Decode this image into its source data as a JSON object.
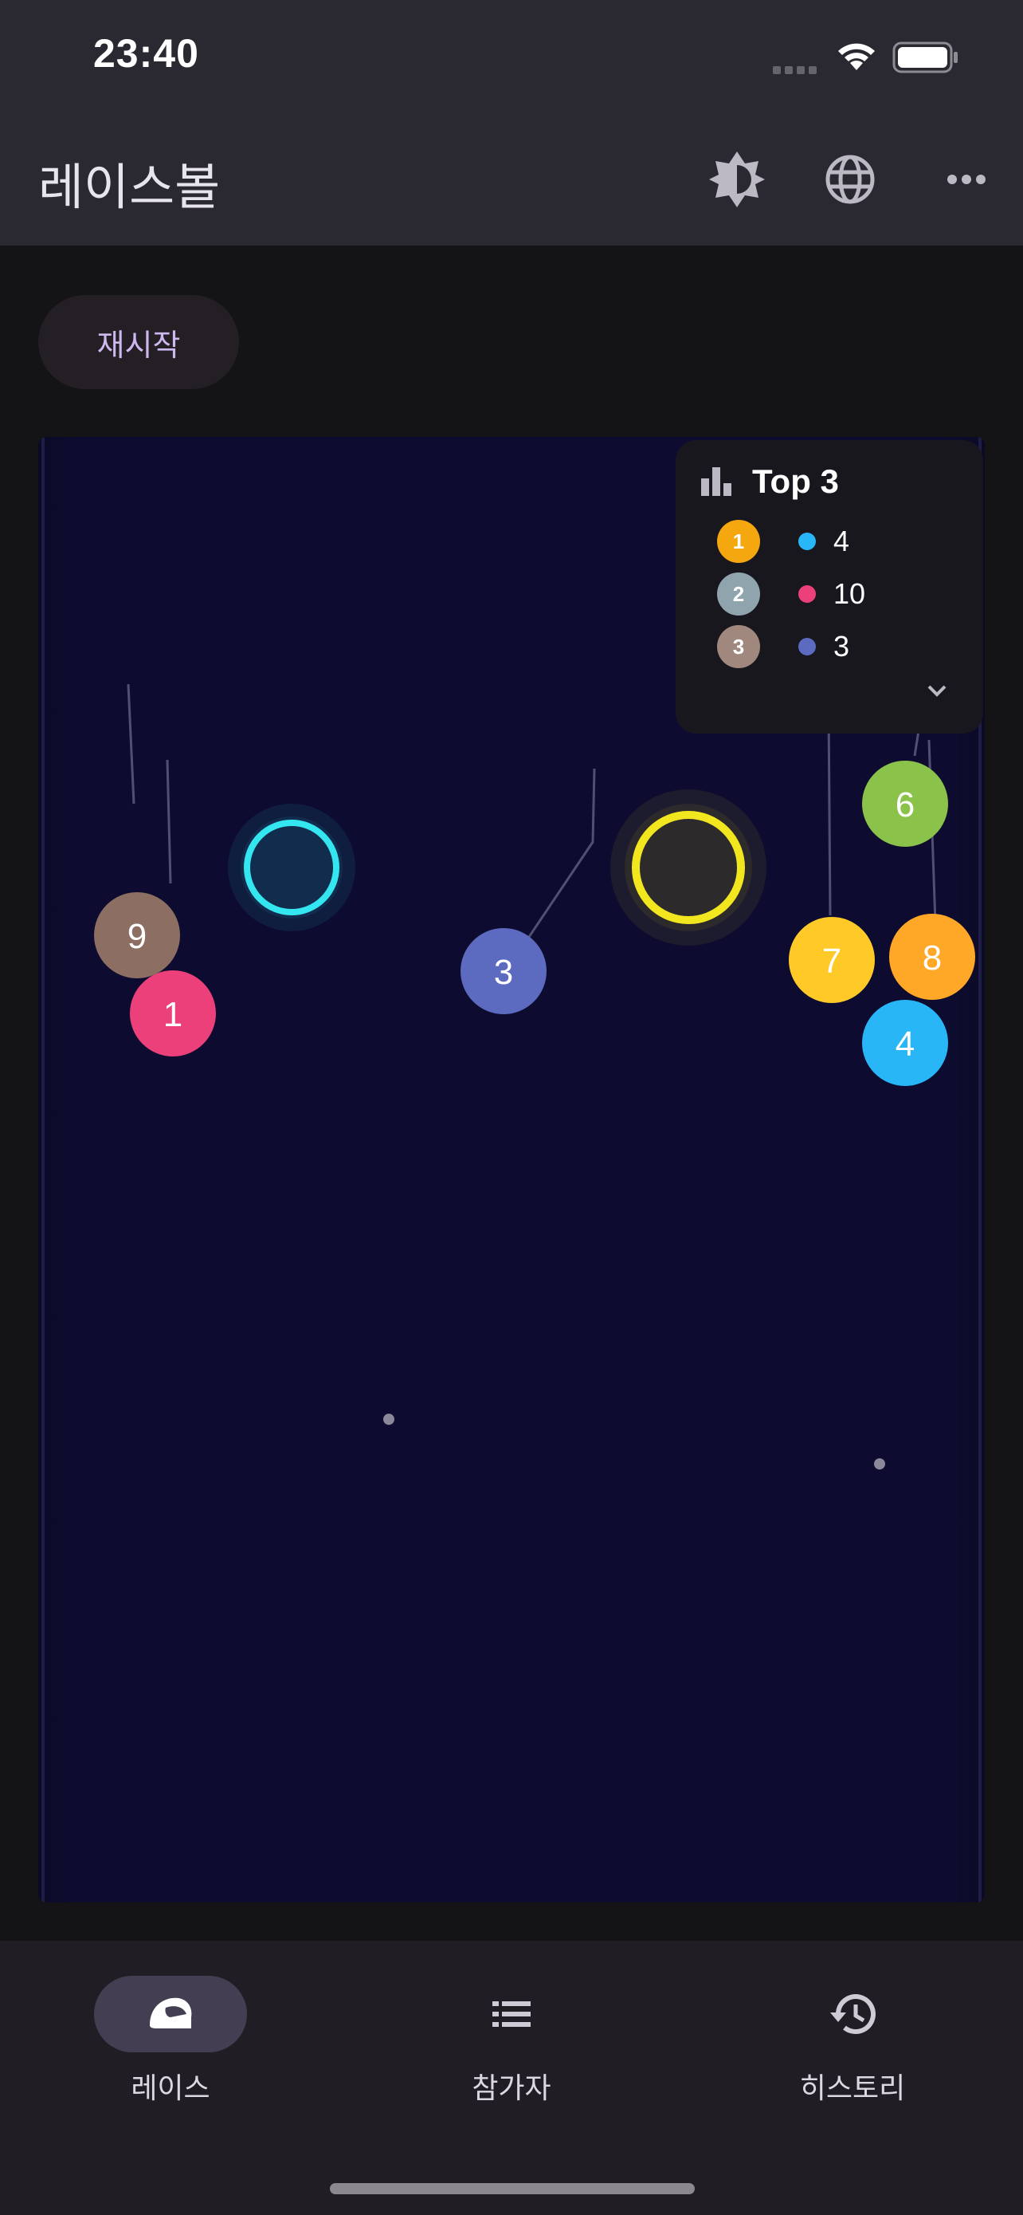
{
  "status_bar": {
    "time": "23:40"
  },
  "app_bar": {
    "title": "레이스볼",
    "actions": [
      "brightness-icon",
      "globe-icon",
      "more-horizontal-icon"
    ]
  },
  "controls": {
    "restart_label": "재시작"
  },
  "top3": {
    "title": "Top 3",
    "rows": [
      {
        "rank": "1",
        "badge_color": "#f5a70f",
        "dot_color": "#29b6f6",
        "value": "4"
      },
      {
        "rank": "2",
        "badge_color": "#90a4ae",
        "dot_color": "#ec407a",
        "value": "10"
      },
      {
        "rank": "3",
        "badge_color": "#a1887f",
        "dot_color": "#5c6bc0",
        "value": "3"
      }
    ]
  },
  "balls": [
    {
      "label": "9",
      "color": "#8d6e63"
    },
    {
      "label": "1",
      "color": "#ec407a"
    },
    {
      "label": "3",
      "color": "#5c6bc0"
    },
    {
      "label": "7",
      "color": "#ffca28"
    },
    {
      "label": "8",
      "color": "#ffa726"
    },
    {
      "label": "6",
      "color": "#8bc34a"
    },
    {
      "label": "4",
      "color": "#29b6f6"
    }
  ],
  "rings": [
    {
      "color": "#33e6f0"
    },
    {
      "color": "#f2e61f"
    }
  ],
  "nav": {
    "items": [
      {
        "label": "레이스",
        "icon": "helmet-icon",
        "active": true
      },
      {
        "label": "참가자",
        "icon": "list-icon",
        "active": false
      },
      {
        "label": "히스토리",
        "icon": "history-icon",
        "active": false
      }
    ]
  }
}
